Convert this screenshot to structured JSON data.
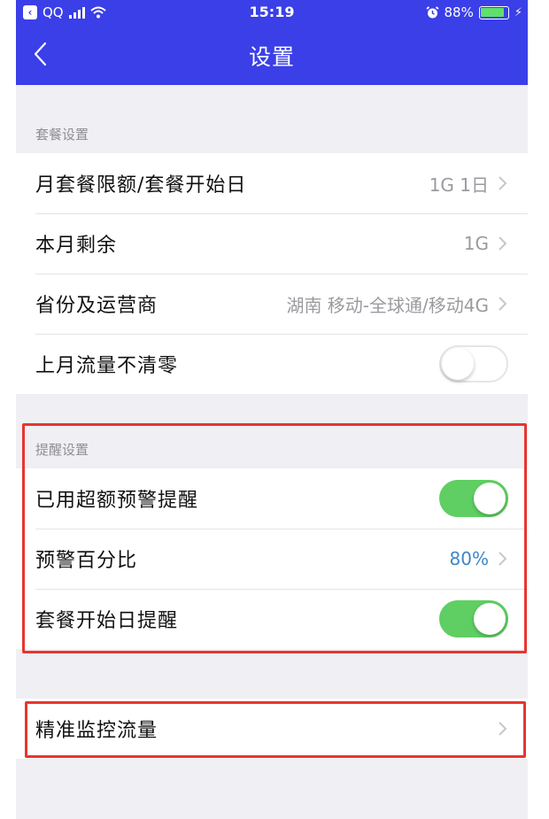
{
  "status_bar": {
    "carrier": "QQ",
    "time": "15:19",
    "battery_percent": "88%",
    "battery_level": 0.88,
    "icons": [
      "qq-back-badge-icon",
      "signal-icon",
      "wifi-icon",
      "alarm-icon",
      "battery-icon",
      "charging-icon"
    ]
  },
  "header": {
    "title": "设置",
    "background_color": "#3a3fe8"
  },
  "package_section": {
    "title": "套餐设置",
    "rows": [
      {
        "label": "月套餐限额/套餐开始日",
        "value": "1G 1日"
      },
      {
        "label": "本月剩余",
        "value": "1G"
      },
      {
        "label": "省份及运营商",
        "value": "湖南 移动-全球通/移动4G"
      },
      {
        "label": "上月流量不清零",
        "toggle": false
      }
    ]
  },
  "reminder_section": {
    "title": "提醒设置",
    "rows": [
      {
        "label": "已用超额预警提醒",
        "toggle": true
      },
      {
        "label": "预警百分比",
        "value": "80%"
      },
      {
        "label": "套餐开始日提醒",
        "toggle": true
      }
    ]
  },
  "monitor": {
    "label": "精准监控流量"
  },
  "colors": {
    "toggle_on": "#5fcf63",
    "highlight": "#e8352f",
    "value_blue": "#3e86c9"
  }
}
